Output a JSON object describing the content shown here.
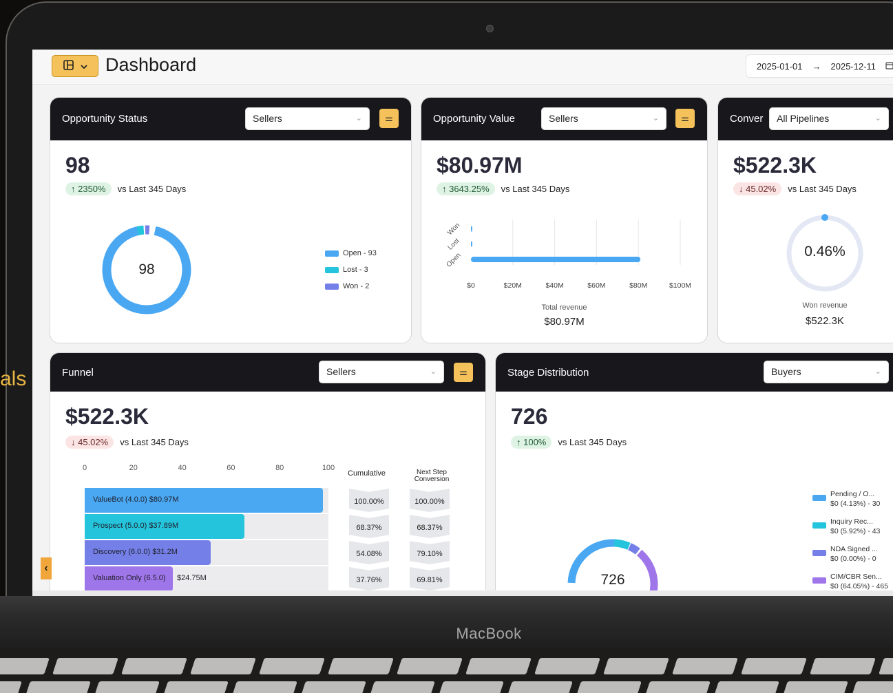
{
  "side_text": "als",
  "brand": "MacBook",
  "header": {
    "title": "Dashboard",
    "date_from": "2025-01-01",
    "date_arrow": "→",
    "date_to": "2025-12-11"
  },
  "cards": {
    "opportunity_status": {
      "title": "Opportunity Status",
      "select": "Sellers",
      "value": "98",
      "change": "↑ 2350%",
      "change_direction": "up",
      "compare": "vs Last 345 Days",
      "donut_center": "98",
      "legend": [
        "Open - 93",
        "Lost - 3",
        "Won - 2"
      ],
      "colors": [
        "#4aa8f2",
        "#25c4dd",
        "#7480e8"
      ]
    },
    "opportunity_value": {
      "title": "Opportunity Value",
      "select": "Sellers",
      "value": "$80.97M",
      "change": "↑ 3643.25%",
      "change_direction": "up",
      "compare": "vs Last 345 Days",
      "footer_label": "Total revenue",
      "footer_value": "$80.97M"
    },
    "conversion": {
      "title": "Conver",
      "select": "All Pipelines",
      "value": "$522.3K",
      "change": "↓ 45.02%",
      "change_direction": "down",
      "compare": "vs Last 345 Days",
      "gauge_value": "0.46%",
      "footer_label": "Won revenue",
      "footer_value": "$522.3K"
    },
    "funnel": {
      "title": "Funnel",
      "select": "Sellers",
      "value": "$522.3K",
      "change": "↓ 45.02%",
      "change_direction": "down",
      "compare": "vs Last 345 Days",
      "axis_ticks": [
        "0",
        "20",
        "40",
        "60",
        "80",
        "100"
      ],
      "cumulative_header": "Cumulative",
      "next_step_header_1": "Next Step",
      "next_step_header_2": "Conversion",
      "rows": [
        {
          "label": "ValueBot (4.0.0)   $80.97M",
          "percent": 100,
          "color": "#4aa8f2",
          "cumulative": "100.00%",
          "next": "100.00%"
        },
        {
          "label": "Prospect (5.0.0)   $37.89M",
          "percent": 67,
          "color": "#25c4dd",
          "cumulative": "68.37%",
          "next": "68.37%"
        },
        {
          "label": "Discovery (6.0.0)   $31.2M",
          "percent": 53,
          "color": "#7480e8",
          "cumulative": "54.08%",
          "next": "79.10%"
        },
        {
          "label": "Valuation Only (6.5.0)",
          "percent": 37,
          "color": "#9f75ea",
          "cumulative": "37.76%",
          "next": "69.81%"
        }
      ],
      "last_row_value": "$24.75M"
    },
    "stage_distribution": {
      "title": "Stage Distribution",
      "select": "Buyers",
      "value": "726",
      "change": "↑ 100%",
      "change_direction": "up",
      "compare": "vs Last 345 Days",
      "donut_center": "726",
      "legend": [
        {
          "name": "Pending / O...",
          "detail": "$0 (4.13%) - 30",
          "color": "#4aa8f2"
        },
        {
          "name": "Inquiry Rec...",
          "detail": "$0 (5.92%) - 43",
          "color": "#25c4dd"
        },
        {
          "name": "NDA Signed ...",
          "detail": "$0 (0.00%) - 0",
          "color": "#7480e8"
        },
        {
          "name": "CIM/CBR Sen...",
          "detail": "$0 (64.05%) - 465",
          "color": "#9f75ea"
        }
      ]
    }
  },
  "chart_data": [
    {
      "type": "pie",
      "title": "Opportunity Status",
      "categories": [
        "Open",
        "Lost",
        "Won"
      ],
      "values": [
        93,
        3,
        2
      ]
    },
    {
      "type": "bar",
      "title": "Opportunity Value",
      "orientation": "horizontal",
      "categories": [
        "Won",
        "Lost",
        "Open"
      ],
      "values": [
        0,
        0,
        80.97
      ],
      "xlabel": "Total revenue",
      "xticks": [
        "$0",
        "$20M",
        "$40M",
        "$60M",
        "$80M",
        "$100M"
      ],
      "xlim": [
        0,
        100
      ]
    },
    {
      "type": "bar",
      "title": "Funnel",
      "orientation": "horizontal",
      "categories": [
        "ValueBot (4.0.0)",
        "Prospect (5.0.0)",
        "Discovery (6.0.0)",
        "Valuation Only (6.5.0)"
      ],
      "values": [
        80.97,
        37.89,
        31.2,
        24.75
      ],
      "xlim": [
        0,
        100
      ]
    }
  ]
}
